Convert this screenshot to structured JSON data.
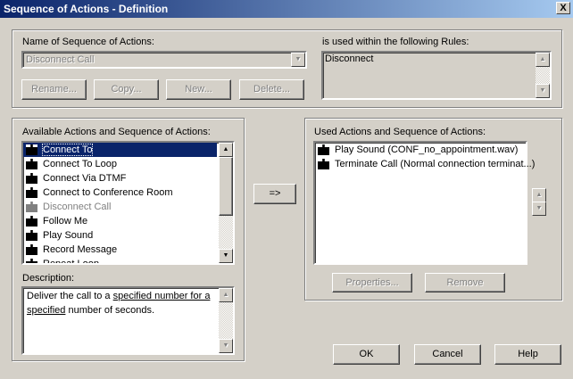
{
  "window": {
    "title": "Sequence of Actions - Definition",
    "close": "X"
  },
  "name_section": {
    "label": "Name of Sequence of Actions:",
    "value": "Disconnect Call",
    "buttons": [
      "Rename...",
      "Copy...",
      "New...",
      "Delete..."
    ]
  },
  "rules": {
    "label": "is used within the following Rules:",
    "items": [
      "Disconnect"
    ]
  },
  "available": {
    "label": "Available Actions and Sequence of Actions:",
    "items": [
      {
        "label": "Connect To",
        "selected": true
      },
      {
        "label": "Connect To Loop"
      },
      {
        "label": "Connect Via DTMF"
      },
      {
        "label": "Connect to Conference Room"
      },
      {
        "label": "Disconnect Call",
        "disabled": true
      },
      {
        "label": "Follow Me"
      },
      {
        "label": "Play Sound"
      },
      {
        "label": "Record Message"
      },
      {
        "label": "Repeat Loop"
      }
    ]
  },
  "description": {
    "label": "Description:",
    "text_parts": [
      "Deliver the call to a ",
      "specified number for a",
      "specified",
      " number of seconds."
    ]
  },
  "add_button": "=>",
  "used": {
    "label": "Used Actions and Sequence of Actions:",
    "items": [
      "Play Sound (CONF_no_appointment.wav)",
      "Terminate Call (Normal connection terminat...)"
    ],
    "properties": "Properties...",
    "remove": "Remove"
  },
  "footer": {
    "ok": "OK",
    "cancel": "Cancel",
    "help": "Help"
  }
}
